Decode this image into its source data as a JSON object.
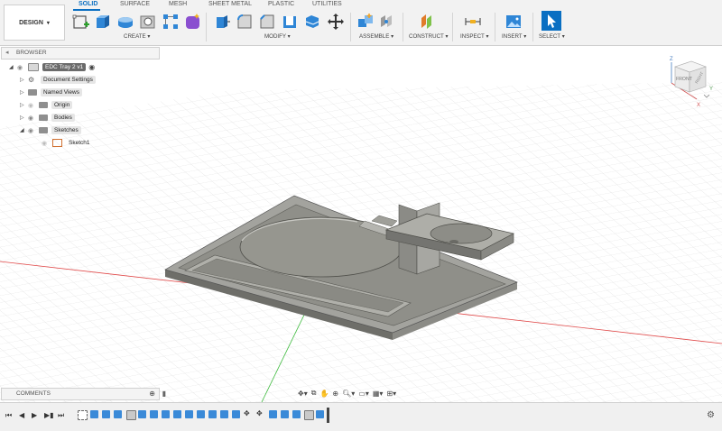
{
  "toolbar": {
    "workspace": "DESIGN",
    "tabs": [
      {
        "label": "SOLID",
        "active": true
      },
      {
        "label": "SURFACE",
        "active": false
      },
      {
        "label": "MESH",
        "active": false
      },
      {
        "label": "SHEET METAL",
        "active": false
      },
      {
        "label": "PLASTIC",
        "active": false
      },
      {
        "label": "UTILITIES",
        "active": false
      }
    ],
    "groups": [
      "CREATE",
      "MODIFY",
      "ASSEMBLE",
      "CONSTRUCT",
      "INSPECT",
      "INSERT",
      "SELECT"
    ]
  },
  "browser": {
    "title": "BROWSER",
    "root": "EDC Tray 2 v1",
    "items": [
      {
        "label": "Document Settings"
      },
      {
        "label": "Named Views"
      },
      {
        "label": "Origin"
      },
      {
        "label": "Bodies"
      },
      {
        "label": "Sketches"
      },
      {
        "label": "Sketch1"
      }
    ]
  },
  "comments": {
    "title": "COMMENTS"
  },
  "viewcube": {
    "front_label": "FRONT",
    "right_label": "RIGHT",
    "axes": [
      "Z",
      "Y",
      "X"
    ]
  },
  "colors": {
    "accent": "#0a6fc2",
    "model": "#8f8f89",
    "grid": "#d8d8d8",
    "x_axis": "#e04848",
    "y_axis": "#3cba3c"
  }
}
